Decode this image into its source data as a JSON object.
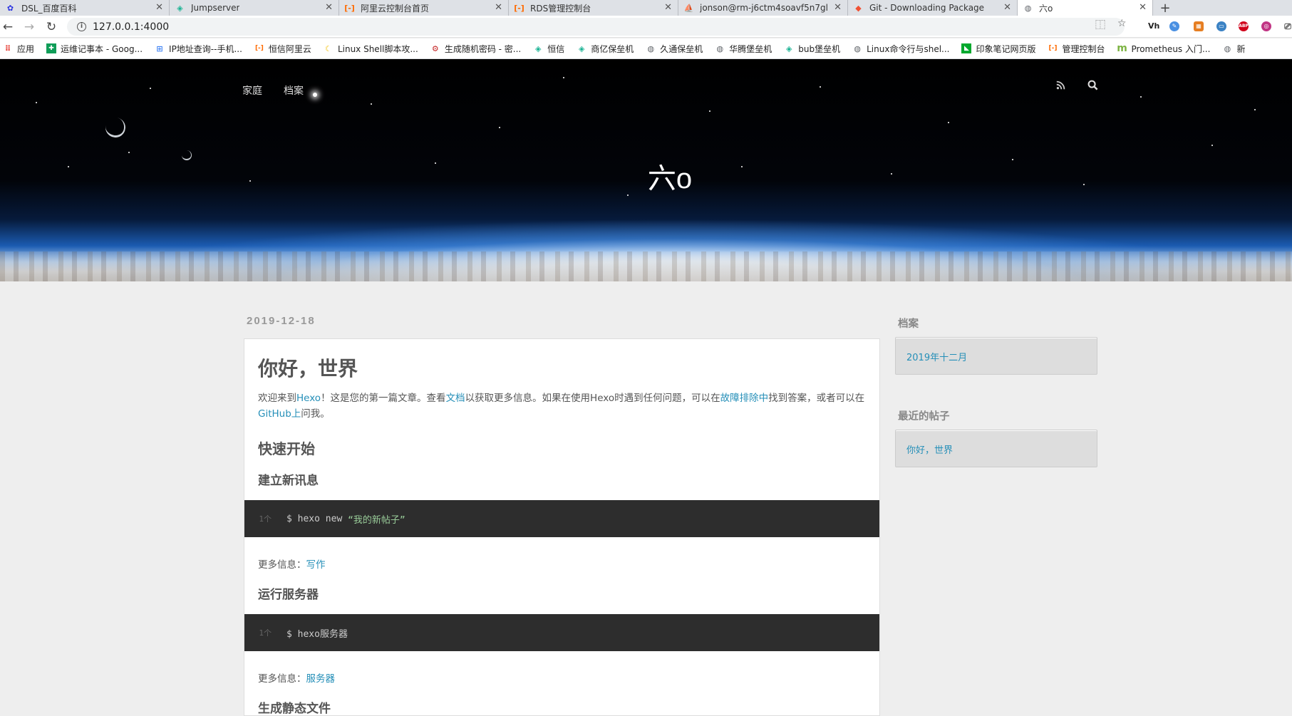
{
  "browser": {
    "tabs": [
      {
        "title": "DSL_百度百科",
        "icon": "baidu-paw-icon",
        "color": "#2932e1"
      },
      {
        "title": "Jumpserver",
        "icon": "jumpserver-icon",
        "color": "#1ab394"
      },
      {
        "title": "阿里云控制台首页",
        "icon": "aliyun-icon",
        "color": "#ff6a00"
      },
      {
        "title": "RDS管理控制台",
        "icon": "aliyun-icon",
        "color": "#ff6a00"
      },
      {
        "title": "jonson@rm-j6ctm4soavf5n7gl",
        "icon": "phpmyadmin-icon",
        "color": "#f29111"
      },
      {
        "title": "Git - Downloading Package",
        "icon": "git-icon",
        "color": "#f05133"
      },
      {
        "title": "六o",
        "icon": "globe-icon",
        "color": "#5f6368",
        "active": true
      }
    ],
    "url": "127.0.0.1:4000",
    "bookmarks": [
      {
        "label": "应用",
        "icon": "apps-grid-icon",
        "color": "#e8453c"
      },
      {
        "label": "运维记事本 - Goog...",
        "icon": "google-sheets-icon",
        "color": "#0f9d58"
      },
      {
        "label": "IP地址查询--手机...",
        "icon": "ip-query-icon",
        "color": "#4285f4"
      },
      {
        "label": "恒信阿里云",
        "icon": "aliyun-icon",
        "color": "#ff6a00"
      },
      {
        "label": "Linux Shell脚本攻...",
        "icon": "banana-icon",
        "color": "#f4c20d"
      },
      {
        "label": "生成随机密码 - 密...",
        "icon": "password-generator-icon",
        "color": "#c62828"
      },
      {
        "label": "恒信",
        "icon": "jumpserver-icon",
        "color": "#1ab394"
      },
      {
        "label": "商亿保垒机",
        "icon": "jumpserver-icon",
        "color": "#1ab394"
      },
      {
        "label": "久通保垒机",
        "icon": "globe-icon",
        "color": "#5f6368"
      },
      {
        "label": "华腾堡垒机",
        "icon": "globe-icon",
        "color": "#5f6368"
      },
      {
        "label": "bub堡垒机",
        "icon": "jumpserver-icon",
        "color": "#1ab394"
      },
      {
        "label": "Linux命令行与shel...",
        "icon": "globe-icon",
        "color": "#5f6368"
      },
      {
        "label": "印象笔记网页版",
        "icon": "evernote-icon",
        "color": "#00a82d"
      },
      {
        "label": "管理控制台",
        "icon": "aliyun-icon",
        "color": "#ff6a00"
      },
      {
        "label": "Prometheus 入门...",
        "icon": "m-logo-icon",
        "color": "#7cb342"
      },
      {
        "label": "新",
        "icon": "globe-icon",
        "color": "#5f6368"
      }
    ],
    "extensions": [
      {
        "label": "Vh",
        "icon": "vh-icon",
        "color": "#222222"
      },
      {
        "label": "",
        "icon": "feather-icon",
        "color": "#4a90e2"
      },
      {
        "label": "",
        "icon": "grid-extension-icon",
        "color": "#e67e22"
      },
      {
        "label": "",
        "icon": "chat-extension-icon",
        "color": "#3b82c4"
      },
      {
        "label": "ABP",
        "icon": "adblock-plus-icon",
        "color": "#d0021b"
      },
      {
        "label": "",
        "icon": "instagram-icon",
        "color": "#c13584"
      },
      {
        "label": "",
        "icon": "screenshot-icon",
        "color": "#555555"
      }
    ]
  },
  "site": {
    "nav": [
      "家庭",
      "档案"
    ],
    "title": "六o"
  },
  "post": {
    "date": "2019-12-18",
    "title": "你好，世界",
    "intro": {
      "p1": "欢迎来到",
      "link_hexo": "Hexo",
      "p2": "！这是您的第一篇文章。查看",
      "link_docs": "文档",
      "p3": "以获取更多信息。如果在使用Hexo时遇到任何问题，可以在",
      "link_troubleshoot": "故障排除中",
      "p4": "找到答案，或者可以在",
      "link_github": "GitHub上",
      "p5": "问我。"
    },
    "h_quick_start": "快速开始",
    "h_create_post": "建立新讯息",
    "code1": {
      "line": "1个",
      "cmd": "$ hexo new ",
      "arg": "“我的新帖子”"
    },
    "more1": {
      "label": "更多信息：",
      "link": "写作"
    },
    "h_run_server": "运行服务器",
    "code2": {
      "line": "1个",
      "cmd": "$ hexo服务器"
    },
    "more2": {
      "label": "更多信息：",
      "link": "服务器"
    },
    "h_generate": "生成静态文件"
  },
  "sidebar": {
    "archives_heading": "档案",
    "archives_item": "2019年十二月",
    "recent_heading": "最近的帖子",
    "recent_item": "你好，世界"
  }
}
